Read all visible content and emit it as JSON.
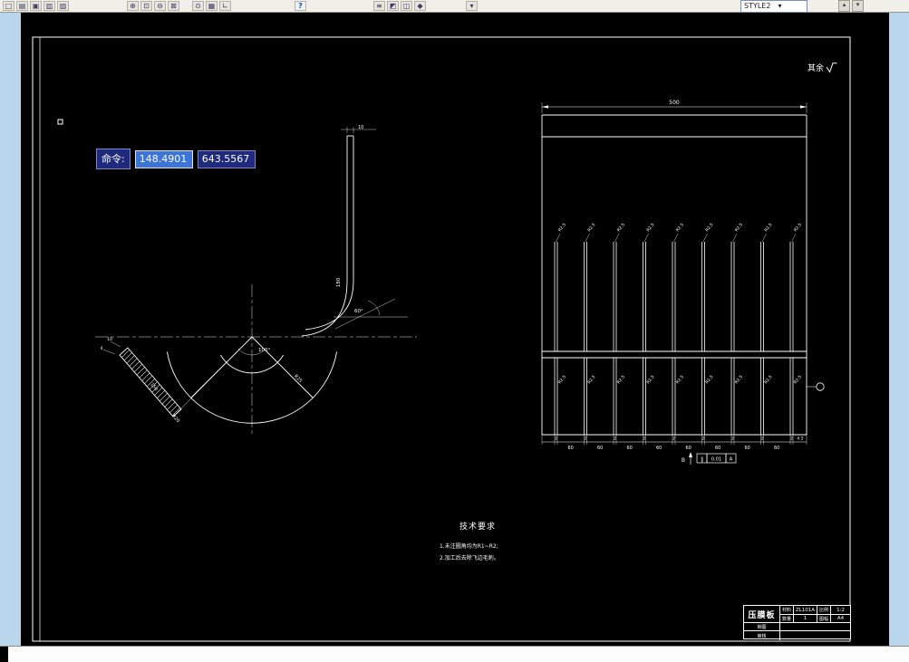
{
  "toolbar": {
    "icons": [
      {
        "name": "new",
        "glyph": "□"
      },
      {
        "name": "open",
        "glyph": "▤"
      },
      {
        "name": "save",
        "glyph": "▣"
      },
      {
        "name": "print",
        "glyph": "▥"
      },
      {
        "name": "plot-preview",
        "glyph": "▧"
      },
      {
        "name": "zoom-realtime",
        "glyph": "⊕"
      },
      {
        "name": "zoom-window",
        "glyph": "⊡"
      },
      {
        "name": "zoom-previous",
        "glyph": "⊖"
      },
      {
        "name": "zoom-extents",
        "glyph": "⊠"
      },
      {
        "name": "osnap",
        "glyph": "⊙"
      },
      {
        "name": "grid",
        "glyph": "▦"
      },
      {
        "name": "ucs",
        "glyph": "∟"
      },
      {
        "name": "help",
        "glyph": "?"
      },
      {
        "name": "layers",
        "glyph": "≡"
      },
      {
        "name": "render",
        "glyph": "◩"
      },
      {
        "name": "views",
        "glyph": "◫"
      },
      {
        "name": "tools",
        "glyph": "◆"
      },
      {
        "name": "dropdown-arrow",
        "glyph": "▾"
      }
    ],
    "style_combo": "STYLE2",
    "scroll_up": "▴",
    "scroll_down": "▾"
  },
  "command": {
    "label": "命令:",
    "x_value": "148.4901",
    "y_value": "643.5567"
  },
  "drawing": {
    "surface_note": "其余",
    "tech": {
      "title": "技术要求",
      "item1": "1.未注圆角均为R1~R2;",
      "item2": "2.加工后去除飞边毛刺。"
    },
    "left_view": {
      "top_thickness": "10",
      "wall_height": "180",
      "wall_angle": "60°",
      "fan_angle": "100°",
      "bar_length": "150",
      "bar_dim_a": "10",
      "bar_dim_b": "4",
      "end_radius": "R20",
      "fan_radius": "R25"
    },
    "right_view": {
      "width": "500",
      "slot_label": "R2.5",
      "pitch": "60",
      "slot_width": "2",
      "end_dim": "4.5",
      "section_label": "B",
      "fcf_symbol": "∥",
      "fcf_tol": "0.01",
      "fcf_datum": "A"
    }
  },
  "title_block": {
    "part_name": "压膜板",
    "material_label": "材料",
    "material": "ZL101A",
    "scale_label": "比例",
    "scale": "1:2",
    "qty_label": "数量",
    "qty": "1",
    "sheet_label": "图幅",
    "sheet": "A4",
    "drawn_label": "制图",
    "checked_label": "审核"
  }
}
